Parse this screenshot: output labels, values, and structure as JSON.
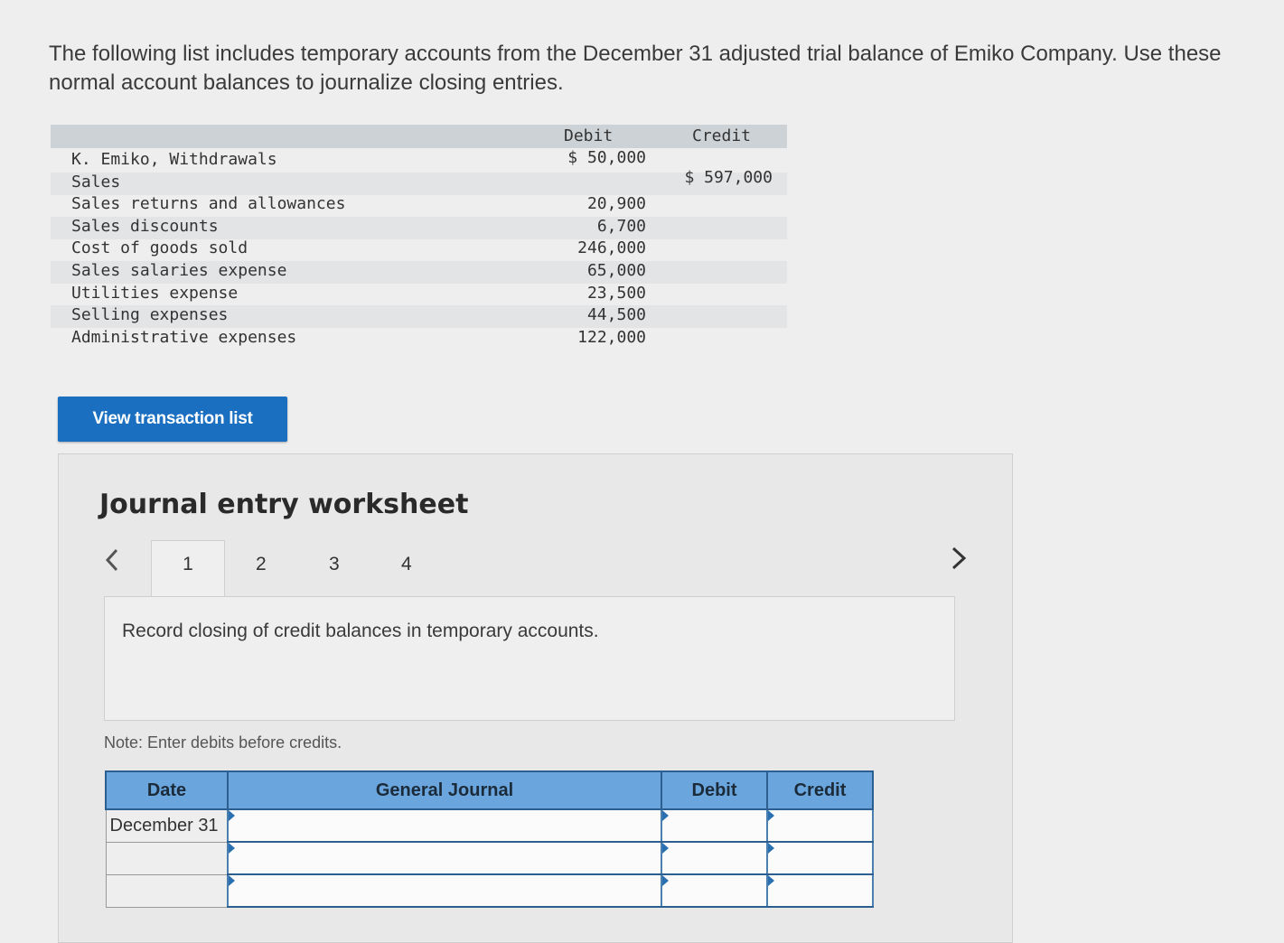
{
  "intro": {
    "line1": "The following list includes temporary accounts from the December 31 adjusted trial balance of Emiko Company. Use these",
    "line2": "normal account balances to journalize closing entries."
  },
  "trial_balance": {
    "debit_header": "Debit",
    "credit_header": "Credit",
    "rows": [
      {
        "name": "K. Emiko, Withdrawals",
        "debit": "$ 50,000",
        "credit": ""
      },
      {
        "name": "Sales",
        "debit": "",
        "credit": "$ 597,000"
      },
      {
        "name": "Sales returns and allowances",
        "debit": "20,900",
        "credit": ""
      },
      {
        "name": "Sales discounts",
        "debit": "6,700",
        "credit": ""
      },
      {
        "name": "Cost of goods sold",
        "debit": "246,000",
        "credit": ""
      },
      {
        "name": "Sales salaries expense",
        "debit": "65,000",
        "credit": ""
      },
      {
        "name": "Utilities expense",
        "debit": "23,500",
        "credit": ""
      },
      {
        "name": "Selling expenses",
        "debit": "44,500",
        "credit": ""
      },
      {
        "name": "Administrative expenses",
        "debit": "122,000",
        "credit": ""
      }
    ]
  },
  "view_button": "View transaction list",
  "worksheet": {
    "title": "Journal entry worksheet",
    "tabs": [
      "1",
      "2",
      "3",
      "4"
    ],
    "active_tab": "1",
    "instruction": "Record closing of credit balances in temporary accounts.",
    "note": "Note: Enter debits before credits.",
    "columns": [
      "Date",
      "General Journal",
      "Debit",
      "Credit"
    ],
    "rows": [
      {
        "date": "December 31"
      },
      {
        "date": ""
      },
      {
        "date": ""
      }
    ]
  },
  "icons": {
    "prev": "chevron-left-icon",
    "next": "chevron-right-icon"
  },
  "colors": {
    "button": "#1a6fc1",
    "table_header": "#6aa6dd"
  }
}
